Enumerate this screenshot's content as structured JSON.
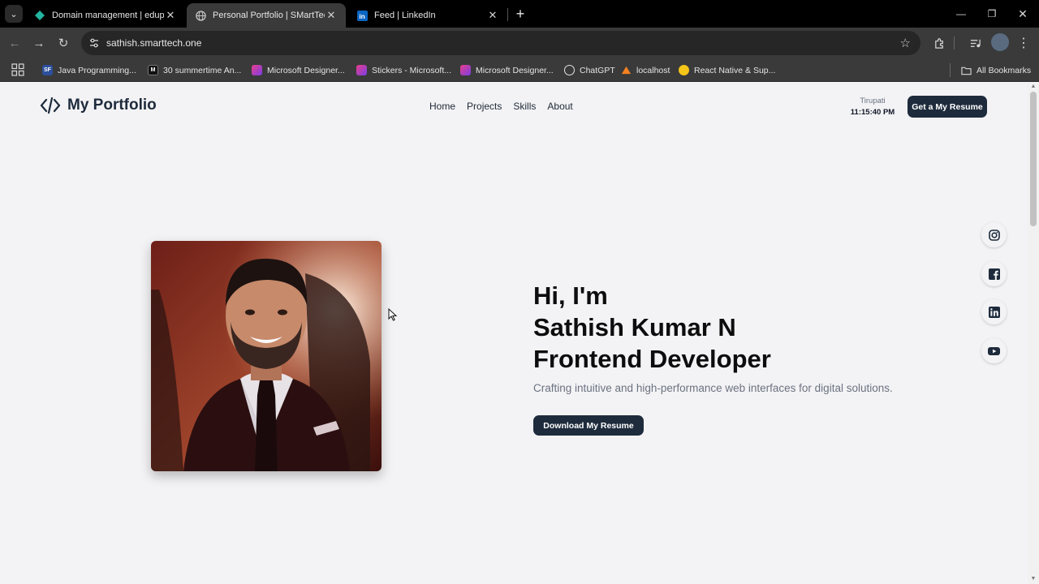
{
  "browser": {
    "tabs": [
      {
        "title": "Domain management | edupoly",
        "active": false
      },
      {
        "title": "Personal Portfolio | SMartTech",
        "active": true
      },
      {
        "title": "Feed | LinkedIn",
        "active": false
      }
    ],
    "url": "sathish.smarttech.one",
    "bookmarks": [
      {
        "label": "Java Programming...",
        "icon": "sf-icon"
      },
      {
        "label": "30 summertime An...",
        "icon": "m-icon"
      },
      {
        "label": "Microsoft Designer...",
        "icon": "designer-icon"
      },
      {
        "label": "Stickers - Microsoft...",
        "icon": "designer-icon"
      },
      {
        "label": "Microsoft Designer...",
        "icon": "designer-icon"
      },
      {
        "label": "ChatGPT",
        "icon": "chatgpt-icon"
      },
      {
        "label": "localhost",
        "icon": "xampp-icon"
      },
      {
        "label": "React Native & Sup...",
        "icon": "supabase-icon"
      }
    ],
    "all_bookmarks": "All Bookmarks"
  },
  "site": {
    "logo_text": "My Portfolio",
    "nav": [
      "Home",
      "Projects",
      "Skills",
      "About"
    ],
    "clock": {
      "city": "Tirupati",
      "time": "11:15:40 PM"
    },
    "resume_button": "Get a My Resume"
  },
  "hero": {
    "line1": "Hi, I'm",
    "line2": "Sathish Kumar N",
    "line3": "Frontend Developer",
    "tagline": "Crafting intuitive and high-performance web interfaces for digital solutions.",
    "download_button": "Download My Resume"
  },
  "social": [
    "instagram-icon",
    "facebook-icon",
    "linkedin-icon",
    "youtube-icon"
  ],
  "colors": {
    "brand_dark": "#1e2b3c",
    "page_bg": "#f3f3f5",
    "chrome_bg": "#3a3a3a"
  }
}
